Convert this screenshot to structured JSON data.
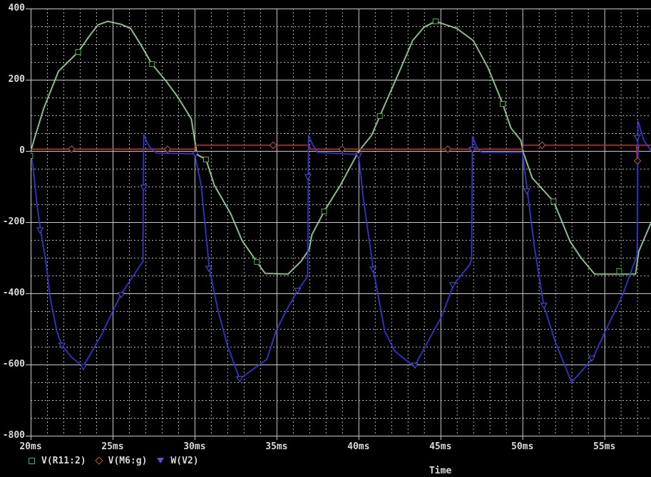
{
  "window": {
    "background": "#000000",
    "grid_color": "#c9c9c9",
    "minor_grid_color": "#b0b0b0",
    "text_color": "#d9d9d9"
  },
  "chart_data": {
    "type": "line",
    "title": "",
    "xlabel": "Time",
    "ylabel": "",
    "x_unit": "ms",
    "x_ticks": [
      20,
      25,
      30,
      35,
      40,
      45,
      50,
      55
    ],
    "x_minor_step_ms": 1,
    "x_range_ms": [
      20,
      57.9
    ],
    "y_ticks": [
      400,
      200,
      0,
      -200,
      -400,
      -600,
      -800
    ],
    "y_minor_step": 50,
    "y_range": [
      -800,
      400
    ],
    "grid": true,
    "legend_position": "bottom-left",
    "series": [
      {
        "name": "V(R11:2)",
        "color": "#a5d8a5",
        "marker": "square",
        "marker_color": "#49b049",
        "points": [
          [
            20.0,
            -2
          ],
          [
            20.2,
            30
          ],
          [
            20.8,
            120
          ],
          [
            21.7,
            224
          ],
          [
            22.9,
            278
          ],
          [
            23.6,
            324
          ],
          [
            24.1,
            354
          ],
          [
            24.7,
            364
          ],
          [
            25.5,
            356
          ],
          [
            26.1,
            344
          ],
          [
            26.7,
            300
          ],
          [
            27.4,
            244
          ],
          [
            28.3,
            194
          ],
          [
            29.0,
            150
          ],
          [
            29.8,
            90
          ],
          [
            30.05,
            20
          ],
          [
            30.15,
            -10
          ],
          [
            30.7,
            -24
          ],
          [
            31.2,
            -96
          ],
          [
            32.2,
            -176
          ],
          [
            32.9,
            -252
          ],
          [
            33.8,
            -312
          ],
          [
            34.3,
            -344
          ],
          [
            35.7,
            -346
          ],
          [
            36.5,
            -310
          ],
          [
            37.0,
            -276
          ],
          [
            37.15,
            -236
          ],
          [
            37.9,
            -170
          ],
          [
            38.9,
            -96
          ],
          [
            40.0,
            -2
          ],
          [
            40.8,
            44
          ],
          [
            41.3,
            98
          ],
          [
            42.5,
            224
          ],
          [
            43.3,
            310
          ],
          [
            44.0,
            348
          ],
          [
            44.7,
            364
          ],
          [
            46.0,
            344
          ],
          [
            47.0,
            310
          ],
          [
            47.9,
            234
          ],
          [
            48.8,
            132
          ],
          [
            49.3,
            64
          ],
          [
            49.9,
            30
          ],
          [
            50.05,
            -4
          ],
          [
            50.6,
            -76
          ],
          [
            51.9,
            -142
          ],
          [
            52.3,
            -186
          ],
          [
            52.9,
            -254
          ],
          [
            53.6,
            -302
          ],
          [
            54.4,
            -346
          ],
          [
            56.9,
            -346
          ],
          [
            57.1,
            -282
          ],
          [
            57.9,
            -196
          ]
        ],
        "marker_points": [
          [
            19.97,
            -14
          ],
          [
            22.9,
            278
          ],
          [
            27.4,
            244
          ],
          [
            30.7,
            -24
          ],
          [
            33.8,
            -312
          ],
          [
            37.9,
            -170
          ],
          [
            41.3,
            98
          ],
          [
            44.7,
            364
          ],
          [
            48.8,
            132
          ],
          [
            51.9,
            -142
          ],
          [
            55.9,
            -338
          ]
        ]
      },
      {
        "name": "V(M6:g)",
        "color": "#b23535",
        "marker": "diamond",
        "marker_color": "#c05a3c",
        "points": [
          [
            20.0,
            5
          ],
          [
            30.0,
            5
          ],
          [
            30.05,
            16
          ],
          [
            37.0,
            16
          ],
          [
            37.05,
            5
          ],
          [
            50.0,
            5
          ],
          [
            50.05,
            16
          ],
          [
            56.95,
            16
          ],
          [
            57.0,
            -28
          ],
          [
            57.1,
            16
          ],
          [
            57.9,
            16
          ]
        ],
        "marker_points": [
          [
            22.5,
            5
          ],
          [
            28.35,
            5
          ],
          [
            34.8,
            16
          ],
          [
            39.0,
            5
          ],
          [
            45.45,
            5
          ],
          [
            51.2,
            16
          ],
          [
            57.02,
            -28
          ]
        ]
      },
      {
        "name": "W(V2)",
        "color": "#3a3ad2",
        "marker": "triangle-down",
        "marker_color": "#5353e0",
        "points": [
          [
            20.0,
            -2
          ],
          [
            20.15,
            -46
          ],
          [
            20.4,
            -156
          ],
          [
            20.6,
            -222
          ],
          [
            20.9,
            -302
          ],
          [
            21.2,
            -416
          ],
          [
            21.6,
            -506
          ],
          [
            21.9,
            -546
          ],
          [
            22.5,
            -580
          ],
          [
            23.2,
            -606
          ],
          [
            24.3,
            -518
          ],
          [
            25.5,
            -404
          ],
          [
            26.85,
            -310
          ],
          [
            26.9,
            46
          ],
          [
            27.1,
            24
          ],
          [
            27.35,
            6
          ],
          [
            27.7,
            -6
          ],
          [
            30.0,
            -8
          ],
          [
            30.4,
            -96
          ],
          [
            30.9,
            -330
          ],
          [
            31.4,
            -442
          ],
          [
            32.0,
            -546
          ],
          [
            32.75,
            -640
          ],
          [
            34.4,
            -586
          ],
          [
            35.0,
            -502
          ],
          [
            35.7,
            -440
          ],
          [
            36.3,
            -392
          ],
          [
            36.9,
            -352
          ],
          [
            36.95,
            44
          ],
          [
            37.2,
            18
          ],
          [
            37.5,
            -4
          ],
          [
            40.0,
            -10
          ],
          [
            40.3,
            -136
          ],
          [
            40.9,
            -332
          ],
          [
            41.6,
            -506
          ],
          [
            42.2,
            -562
          ],
          [
            43.4,
            -606
          ],
          [
            44.3,
            -530
          ],
          [
            45.1,
            -462
          ],
          [
            45.8,
            -376
          ],
          [
            46.8,
            -318
          ],
          [
            46.9,
            -306
          ],
          [
            46.95,
            40
          ],
          [
            47.2,
            12
          ],
          [
            47.5,
            -4
          ],
          [
            50.0,
            -4
          ],
          [
            50.3,
            -112
          ],
          [
            50.75,
            -276
          ],
          [
            51.3,
            -434
          ],
          [
            52.0,
            -536
          ],
          [
            53.0,
            -650
          ],
          [
            54.3,
            -582
          ],
          [
            55.1,
            -502
          ],
          [
            56.1,
            -406
          ],
          [
            57.0,
            -292
          ],
          [
            57.05,
            84
          ],
          [
            57.4,
            30
          ],
          [
            57.9,
            -2
          ]
        ],
        "marker_points": [
          [
            20.57,
            -222
          ],
          [
            21.91,
            -546
          ],
          [
            23.22,
            -606
          ],
          [
            25.52,
            -404
          ],
          [
            26.9,
            -102
          ],
          [
            30.05,
            -8
          ],
          [
            30.87,
            -330
          ],
          [
            32.75,
            -640
          ],
          [
            36.27,
            -392
          ],
          [
            36.92,
            -72
          ],
          [
            40.01,
            -12
          ],
          [
            40.88,
            -332
          ],
          [
            43.44,
            -602
          ],
          [
            45.75,
            -376
          ],
          [
            46.95,
            4
          ],
          [
            50.27,
            -112
          ],
          [
            51.31,
            -434
          ],
          [
            54.23,
            -582
          ],
          [
            57.0,
            38
          ]
        ]
      }
    ]
  }
}
